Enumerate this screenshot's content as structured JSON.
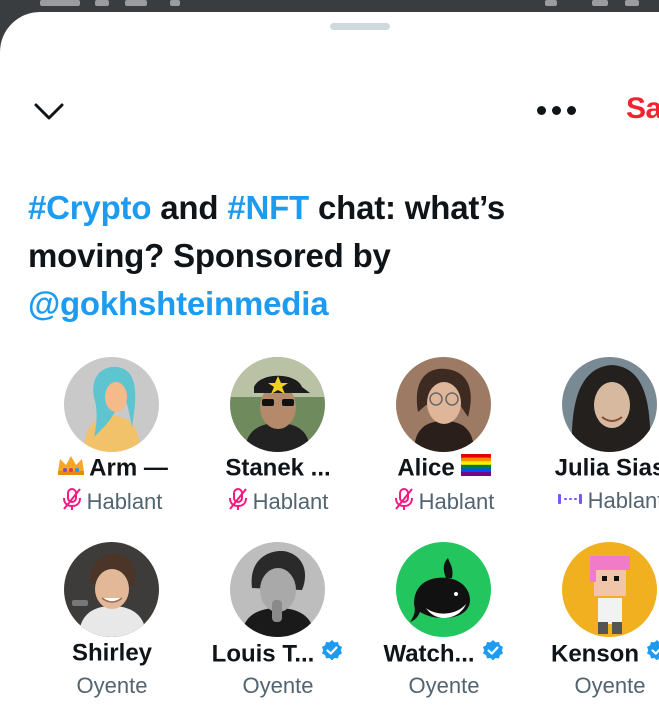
{
  "header": {
    "collapse_icon": "chevron-down-icon",
    "more_icon": "more-horizontal-icon",
    "leave_label": "Sa"
  },
  "space": {
    "title_parts": {
      "tag1": "#Crypto",
      "text1": " and ",
      "tag2": "#NFT",
      "text2": " chat: what’s moving? Sponsored by ",
      "mention": "@gokhshteinmedia"
    }
  },
  "participants": [
    {
      "name": "Arm —",
      "role": "Hablant",
      "role_icon": "mic-off-icon",
      "prefix_icon": "crown-icon"
    },
    {
      "name": "Stanek ...",
      "role": "Hablant",
      "role_icon": "mic-off-icon"
    },
    {
      "name": "Alice",
      "role": "Hablant",
      "role_icon": "mic-off-icon",
      "suffix_icon": "rainbow-flag-icon"
    },
    {
      "name": "Julia Sias",
      "role": "Hablant",
      "role_icon": "speaking-wave-icon"
    },
    {
      "name": "Shirley",
      "role": "Oyente"
    },
    {
      "name": "Louis T...",
      "role": "Oyente",
      "verified": true
    },
    {
      "name": "Watch...",
      "role": "Oyente",
      "verified": true
    },
    {
      "name": "Kenson",
      "role": "Oyente",
      "verified": true
    }
  ],
  "colors": {
    "accent": "#1d9bf0",
    "leave": "#f4212e",
    "speaker_muted": "#f91880",
    "speaking": "#7856ff",
    "text": "#0f1419",
    "secondary": "#536471"
  }
}
